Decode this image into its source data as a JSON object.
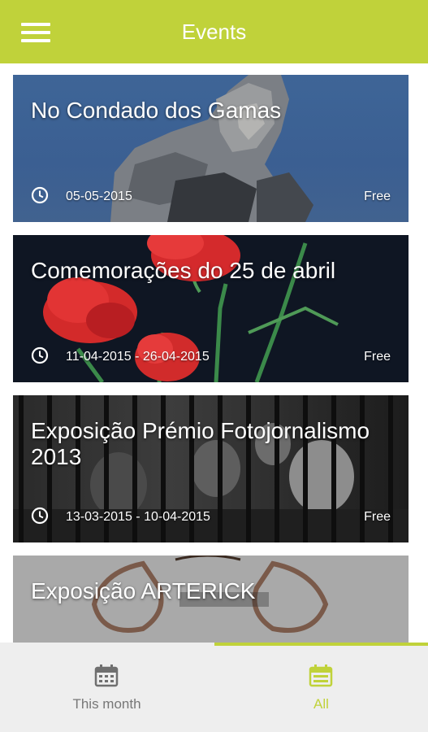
{
  "app_bar": {
    "title": "Events",
    "menu_icon": "hamburger-menu-icon",
    "color": "#c0d23a"
  },
  "events": [
    {
      "title": "No Condado dos Gamas",
      "date": "05-05-2015",
      "price": "Free",
      "image": "statue-photo"
    },
    {
      "title": "Comemorações do 25 de abril",
      "date": "11-04-2015 - 26-04-2015",
      "price": "Free",
      "image": "red-carnations-photo"
    },
    {
      "title": "Exposição Prémio Fotojornalismo 2013",
      "date": "13-03-2015 - 10-04-2015",
      "price": "Free",
      "image": "crowd-behind-gate-photo"
    },
    {
      "title": "Exposição ARTERICK",
      "date": "",
      "price": "",
      "image": "arterick-poster"
    }
  ],
  "bottom_nav": {
    "items": [
      {
        "label": "This month",
        "icon": "calendar-icon",
        "active": false
      },
      {
        "label": "All",
        "icon": "calendar-list-icon",
        "active": true
      }
    ],
    "active_color": "#c0d23a",
    "inactive_color": "#777777"
  }
}
